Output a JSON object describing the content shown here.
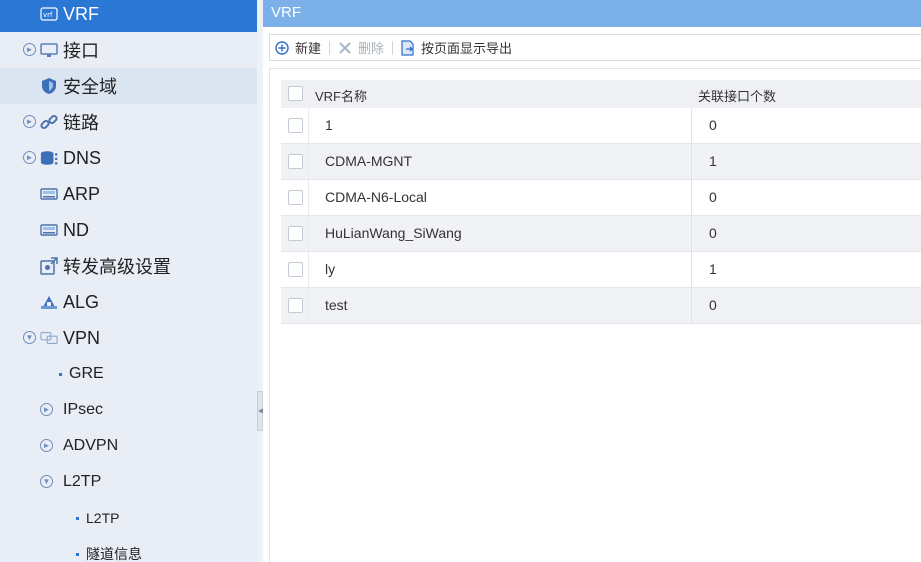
{
  "sidebar": {
    "items": [
      {
        "label": "VRF",
        "icon": "vrf-icon"
      },
      {
        "label": "接口",
        "icon": "monitor-icon",
        "expander": "expand-icon"
      },
      {
        "label": "安全域",
        "icon": "shield-icon"
      },
      {
        "label": "链路",
        "icon": "link-icon",
        "expander": "expand-icon"
      },
      {
        "label": "DNS",
        "icon": "database-icon",
        "expander": "expand-icon"
      },
      {
        "label": "ARP",
        "icon": "network-card-icon"
      },
      {
        "label": "ND",
        "icon": "network-card-icon"
      },
      {
        "label": "转发高级设置",
        "icon": "forward-settings-icon"
      },
      {
        "label": "ALG",
        "icon": "alg-icon"
      },
      {
        "label": "VPN",
        "icon": "vpn-icon",
        "expander": "collapse-icon"
      },
      {
        "label": "GRE"
      },
      {
        "label": "IPsec",
        "expander": "expand-icon"
      },
      {
        "label": "ADVPN",
        "expander": "expand-icon"
      },
      {
        "label": "L2TP",
        "expander": "collapse-icon"
      },
      {
        "label": "L2TP"
      },
      {
        "label": "隧道信息"
      }
    ]
  },
  "header": {
    "title": "VRF"
  },
  "toolbar": {
    "new_label": "新建",
    "delete_label": "删除",
    "export_label": "按页面显示导出"
  },
  "grid": {
    "columns": [
      "VRF名称",
      "关联接口个数"
    ],
    "rows": [
      {
        "name": "1",
        "count": "0"
      },
      {
        "name": "CDMA-MGNT",
        "count": "1"
      },
      {
        "name": "CDMA-N6-Local",
        "count": "0"
      },
      {
        "name": "HuLianWang_SiWang",
        "count": "0"
      },
      {
        "name": "ly",
        "count": "1"
      },
      {
        "name": "test",
        "count": "0"
      }
    ]
  },
  "colors": {
    "sidebar_bg": "#e9edf5",
    "active_item": "#2a77d6",
    "header_bar": "#7bb0e8",
    "row_alt": "#f0f2f6"
  }
}
